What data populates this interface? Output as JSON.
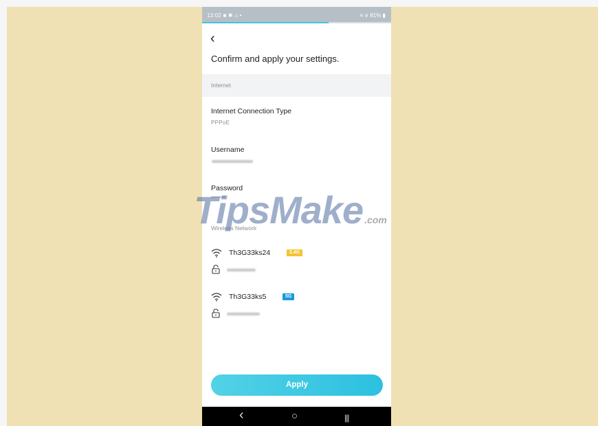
{
  "status_bar": {
    "time": "13:02",
    "notification_icons": "■ ✱ ⌂ •",
    "signal_battery": "≡.∨ 81% ▮"
  },
  "setup_progress": 0.67,
  "header": {
    "back_glyph": "‹",
    "title": "Confirm and apply your settings."
  },
  "internet": {
    "section_label": "Internet",
    "connection_type_label": "Internet Connection Type",
    "connection_type_value": "PPPoE",
    "username_label": "Username",
    "password_label": "Password",
    "password_value": "••••••••••"
  },
  "wireless": {
    "section_label": "Wireless Network",
    "networks": [
      {
        "ssid": "Th3G33ks24",
        "band": "2.4G",
        "band_color": "#f4c430"
      },
      {
        "ssid": "Th3G33ks5",
        "band": "5G",
        "band_color": "#1a9ad9"
      }
    ]
  },
  "apply_label": "Apply",
  "nav": {
    "back": "‹",
    "home": "○",
    "recents": "|||"
  },
  "watermark": {
    "text": "TipsMake",
    "suffix": ".com"
  },
  "colors": {
    "background": "#efe1b4",
    "accent": "#46c3df",
    "apply_gradient_start": "#52d2e6",
    "apply_gradient_end": "#2cc0e0"
  }
}
